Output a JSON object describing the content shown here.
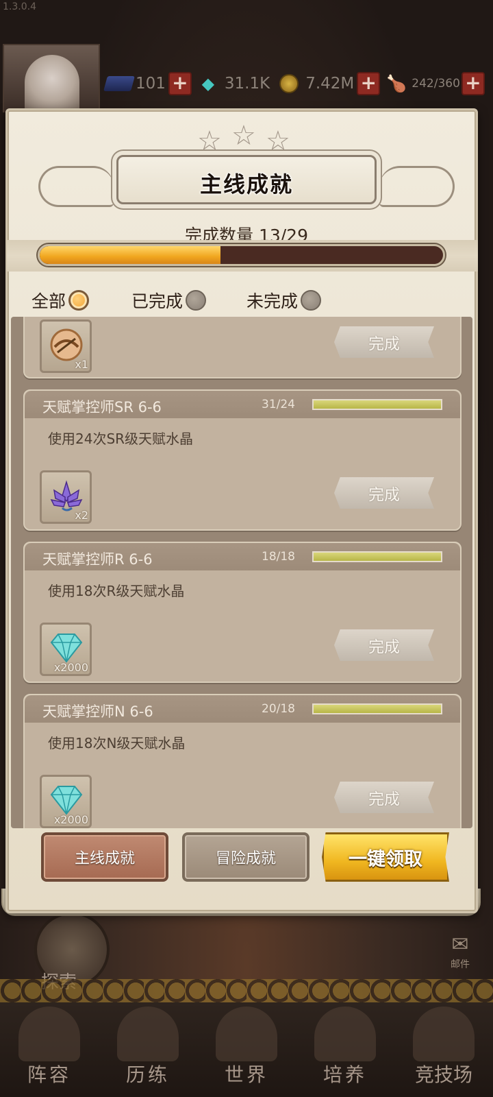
{
  "version": "1.3.0.4",
  "resources": [
    {
      "icon": "tome-icon",
      "value": "101"
    },
    {
      "icon": "diamond-icon",
      "value": "31.1K"
    },
    {
      "icon": "gold-coin-icon",
      "value": "7.42M"
    },
    {
      "icon": "meat-stamina-icon",
      "value": "242/360"
    }
  ],
  "panel": {
    "title": "主线成就",
    "progress_label": "完成数量 13/29",
    "progress": {
      "done": 13,
      "total": 29
    },
    "filters": [
      {
        "label": "全部",
        "selected": true
      },
      {
        "label": "已完成",
        "selected": false
      },
      {
        "label": "未完成",
        "selected": false
      }
    ]
  },
  "achievements": [
    {
      "title": "",
      "count": "",
      "desc": "",
      "reward": {
        "icon": "crossbow-icon",
        "qty": "x1"
      },
      "button": "完成"
    },
    {
      "title": "天赋掌控师SR 6-6",
      "count": "31/24",
      "progress": 1,
      "desc": "使用24次SR级天赋水晶",
      "reward": {
        "icon": "purple-lotus-crystal-icon",
        "qty": "x2"
      },
      "button": "完成"
    },
    {
      "title": "天赋掌控师R 6-6",
      "count": "18/18",
      "progress": 1,
      "desc": "使用18次R级天赋水晶",
      "reward": {
        "icon": "diamond-icon",
        "qty": "x2000"
      },
      "button": "完成"
    },
    {
      "title": "天赋掌控师N 6-6",
      "count": "20/18",
      "progress": 1,
      "desc": "使用18次N级天赋水晶",
      "reward": {
        "icon": "diamond-icon",
        "qty": "x2000"
      },
      "button": "完成"
    }
  ],
  "bottom_buttons": {
    "main": "主线成就",
    "adventure": "冒险成就",
    "claim_all": "一键领取"
  },
  "background": {
    "mail_label": "邮件",
    "explore_label": "探索",
    "nav": [
      "阵容",
      "历练",
      "世界",
      "培养",
      "竞技场"
    ]
  }
}
